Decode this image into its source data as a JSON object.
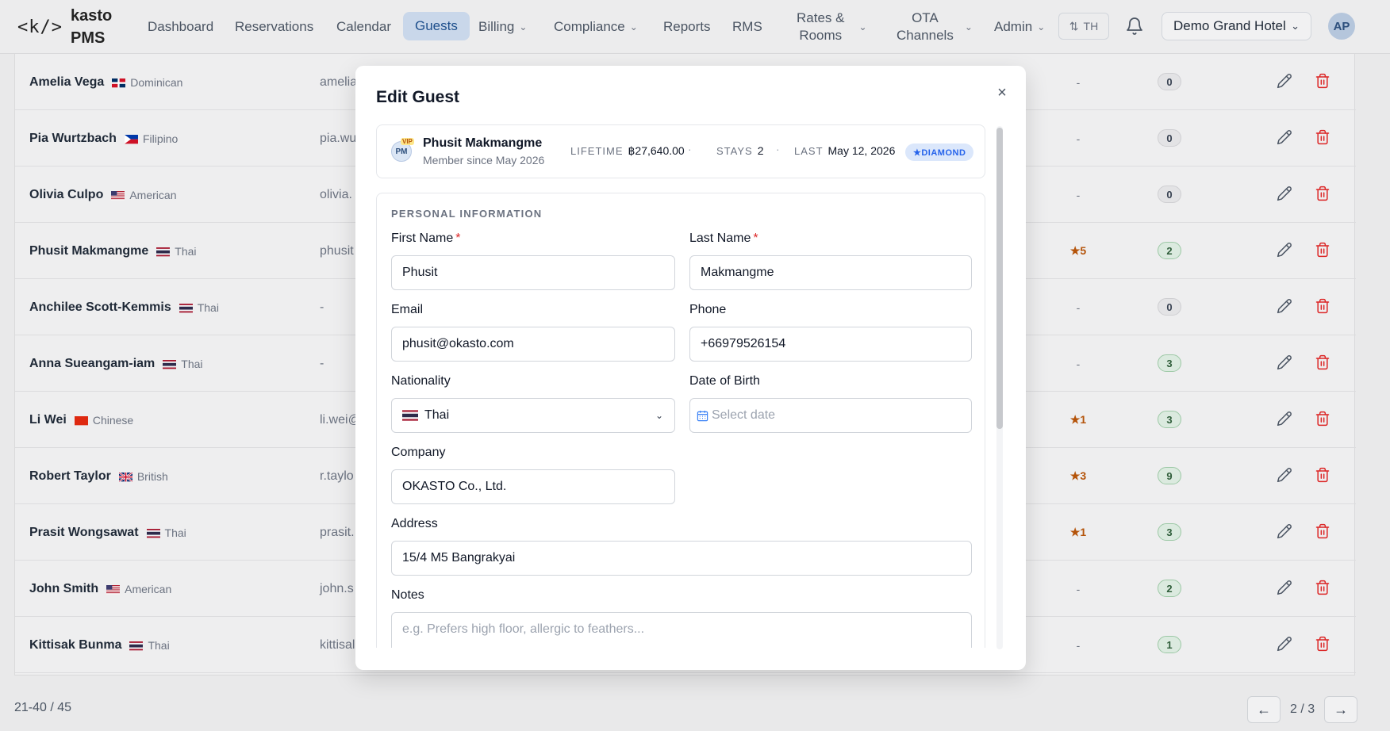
{
  "app": {
    "logo_mark": "<k/>",
    "logo_text_1": "kasto",
    "logo_text_2": "PMS"
  },
  "nav": {
    "dashboard": "Dashboard",
    "reservations": "Reservations",
    "calendar": "Calendar",
    "guests": "Guests",
    "billing": "Billing",
    "compliance": "Compliance",
    "reports": "Reports",
    "rms": "RMS",
    "rates_1": "Rates &",
    "rates_2": "Rooms",
    "ota_1": "OTA",
    "ota_2": "Channels",
    "admin": "Admin",
    "lang": "TH",
    "hotel": "Demo Grand Hotel",
    "avatar": "AP"
  },
  "table": {
    "rows": [
      {
        "name": "Amelia Vega",
        "nationality": "Dominican",
        "email": "amelia",
        "points": "-",
        "count": "0",
        "count_style": "gray"
      },
      {
        "name": "Pia Wurtzbach",
        "nationality": "Filipino",
        "email": "pia.wu",
        "points": "-",
        "count": "0",
        "count_style": "gray"
      },
      {
        "name": "Olivia Culpo",
        "nationality": "American",
        "email": "olivia.",
        "points": "-",
        "count": "0",
        "count_style": "gray"
      },
      {
        "name": "Phusit Makmangme",
        "nationality": "Thai",
        "email": "phusit",
        "points": "★5",
        "count": "2",
        "count_style": "green"
      },
      {
        "name": "Anchilee Scott-Kemmis",
        "nationality": "Thai",
        "email": "-",
        "points": "-",
        "count": "0",
        "count_style": "gray"
      },
      {
        "name": "Anna Sueangam-iam",
        "nationality": "Thai",
        "email": "-",
        "points": "-",
        "count": "3",
        "count_style": "green"
      },
      {
        "name": "Li Wei",
        "nationality": "Chinese",
        "email": "li.wei@",
        "points": "★1",
        "count": "3",
        "count_style": "green"
      },
      {
        "name": "Robert Taylor",
        "nationality": "British",
        "email": "r.taylo",
        "points": "★3",
        "count": "9",
        "count_style": "green"
      },
      {
        "name": "Prasit Wongsawat",
        "nationality": "Thai",
        "email": "prasit.",
        "points": "★1",
        "count": "3",
        "count_style": "green"
      },
      {
        "name": "John Smith",
        "nationality": "American",
        "email": "john.s",
        "points": "-",
        "count": "2",
        "count_style": "green"
      },
      {
        "name": "Kittisak Bunma",
        "nationality": "Thai",
        "email": "kittisal",
        "points": "-",
        "count": "1",
        "count_style": "green"
      }
    ],
    "footer_count": "21-40 / 45",
    "page": "2 / 3",
    "prev": "←",
    "next": "→"
  },
  "modal": {
    "title": "Edit Guest",
    "close": "×",
    "summary": {
      "initials": "PM",
      "vip": "VIP",
      "name": "Phusit Makmangme",
      "since": "Member since May 2026",
      "lifetime_label": "LIFETIME",
      "lifetime_value": "฿27,640.00",
      "stays_label": "STAYS",
      "stays_value": "2",
      "last_label": "LAST",
      "last_value": "May 12, 2026",
      "tier": "★DIAMOND",
      "dot": "·"
    },
    "section_title": "PERSONAL INFORMATION",
    "fields": {
      "first_name_label": "First Name",
      "first_name": "Phusit",
      "last_name_label": "Last Name",
      "last_name": "Makmangme",
      "email_label": "Email",
      "email": "phusit@okasto.com",
      "phone_label": "Phone",
      "phone": "+66979526154",
      "nationality_label": "Nationality",
      "nationality": "Thai",
      "dob_label": "Date of Birth",
      "dob_placeholder": "Select date",
      "company_label": "Company",
      "company": "OKASTO Co., Ltd.",
      "address_label": "Address",
      "address": "15/4 M5 Bangrakyai",
      "notes_label": "Notes",
      "notes_placeholder": "e.g. Prefers high floor, allergic to feathers...",
      "required_mark": "*"
    }
  },
  "colors": {
    "accent": "#1e4f8c",
    "danger": "#dc2626",
    "tier": "#2563eb",
    "star": "#d97706"
  }
}
